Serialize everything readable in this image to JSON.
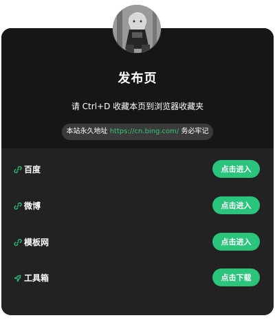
{
  "header": {
    "title": "发布页",
    "subtitle": "请 Ctrl+D 收藏本页到浏览器收藏夹",
    "notice": {
      "prefix": "本站永久地址",
      "url": "https://cn.bing.com/",
      "suffix": "务必牢记"
    }
  },
  "links": [
    {
      "icon": "link-icon",
      "label": "百度",
      "button_label": "点击进入"
    },
    {
      "icon": "link-icon",
      "label": "微博",
      "button_label": "点击进入"
    },
    {
      "icon": "link-icon",
      "label": "模板网",
      "button_label": "点击进入"
    },
    {
      "icon": "rocket-icon",
      "label": "工具箱",
      "button_label": "点击下载"
    }
  ],
  "colors": {
    "accent": "#2bc47c",
    "card_top": "#161616",
    "card_bottom": "#222222",
    "notice_bg": "#3a3a3a",
    "link_text": "#34c77b"
  }
}
